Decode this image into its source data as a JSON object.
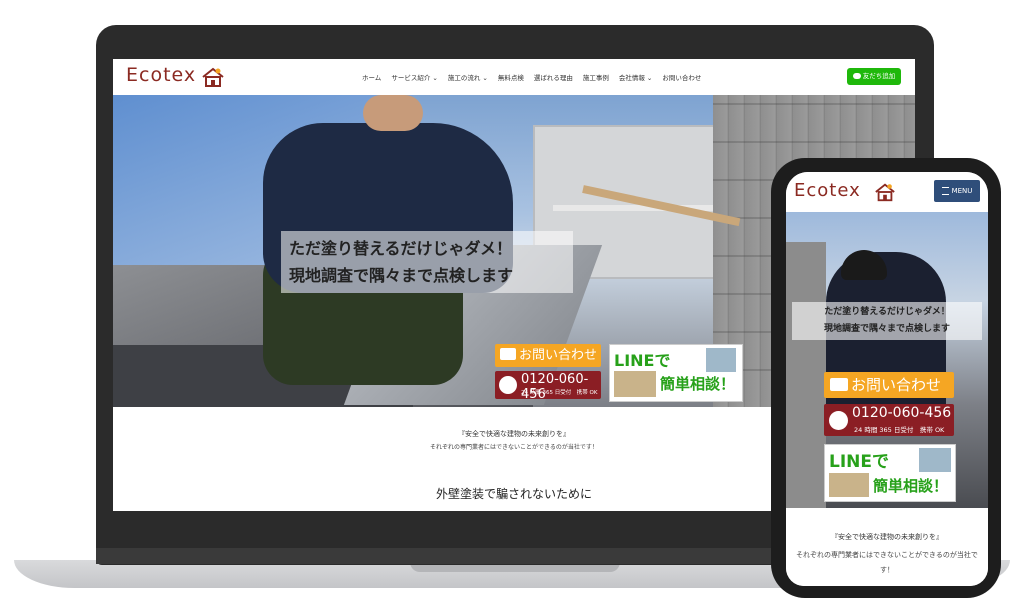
{
  "desktop": {
    "logo": "Ecotex",
    "nav": [
      "ホーム",
      "サービス紹介 ⌄",
      "施工の流れ ⌄",
      "無料点検",
      "選ばれる理由",
      "施工事例",
      "会社情報 ⌄",
      "お問い合わせ"
    ],
    "line_button": "友だち追加",
    "headline_1": "ただ塗り替えるだけじゃダメ！",
    "headline_2": "現地調査で隅々まで点検します",
    "contact_button": "お問い合わせ",
    "phone": "0120-060-456",
    "phone_hours": "24 時間 365 日受付　携帯 OK",
    "line_banner_1": "LINEで",
    "line_banner_2": "簡単相談！",
    "tagline": "『安全で快適な建物の未来創りを』",
    "subtagline": "それぞれの専門業者にはできないことができるのが当社です！",
    "section_title": "外壁塗装で騙されないために"
  },
  "mobile": {
    "logo": "Ecotex",
    "menu_button": "MENU",
    "headline_1": "ただ塗り替えるだけじゃダメ！",
    "headline_2": "現地調査で隅々まで点検します",
    "contact_button": "お問い合わせ",
    "phone": "0120-060-456",
    "phone_hours": "24 時間 365 日受付　携帯 OK",
    "line_banner_1": "LINEで",
    "line_banner_2": "簡単相談！",
    "tagline": "『安全で快適な建物の未来創りを』",
    "subtagline": "それぞれの専門業者にはできないことができるのが当社です！"
  },
  "colors": {
    "brand": "#8b2a22",
    "line_green": "#1fb80b",
    "contact_orange": "#f5a623",
    "phone_red": "#8b1e24",
    "menu_blue": "#2f4e7a"
  },
  "icons": [
    "house-logo-icon",
    "line-bubble-icon",
    "envelope-icon",
    "phone-icon",
    "menu-bars-icon"
  ]
}
